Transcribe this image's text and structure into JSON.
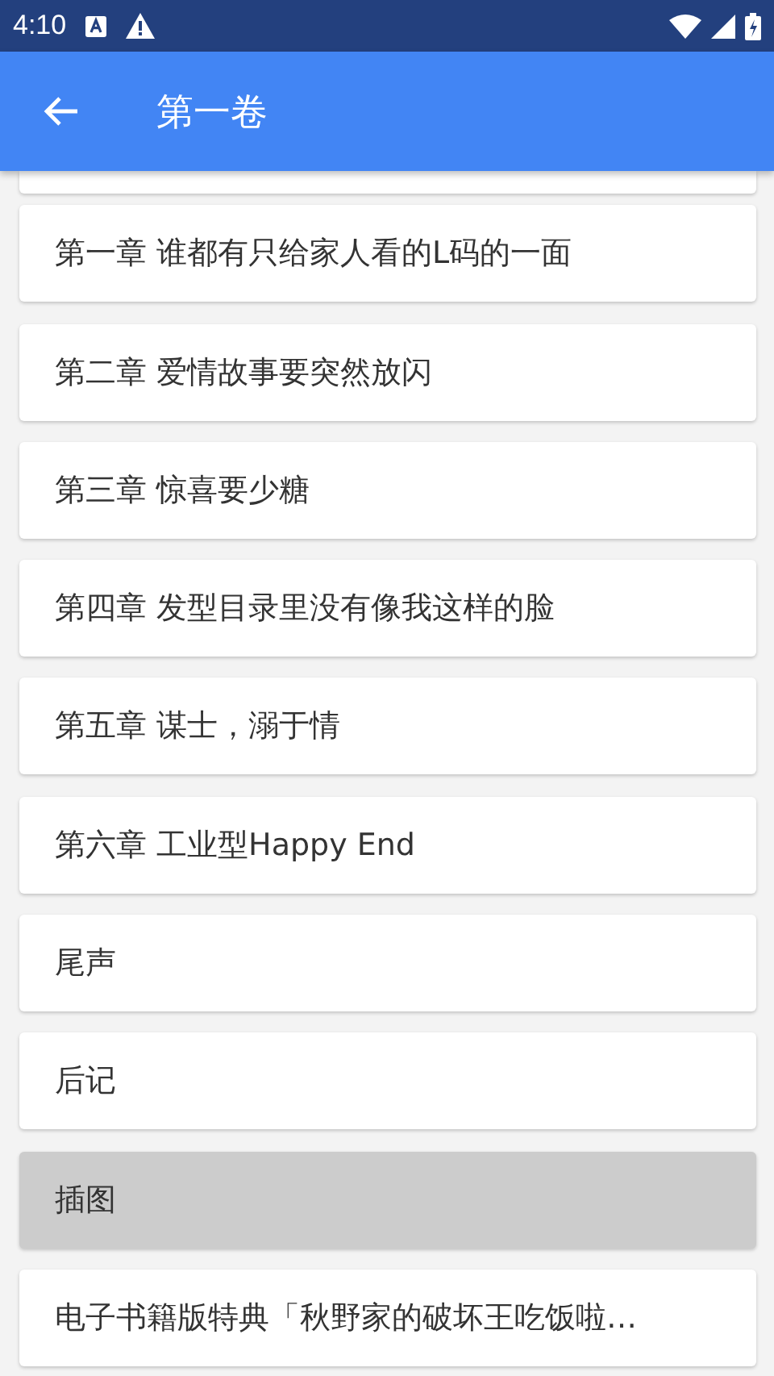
{
  "status_bar": {
    "time": "4:10"
  },
  "app_bar": {
    "title": "第一卷"
  },
  "chapters": [
    {
      "title": "第一章 谁都有只给家人看的L码的一面",
      "selected": false
    },
    {
      "title": "第二章 爱情故事要突然放闪",
      "selected": false
    },
    {
      "title": "第三章 惊喜要少糖",
      "selected": false
    },
    {
      "title": "第四章 发型目录里没有像我这样的脸",
      "selected": false
    },
    {
      "title": "第五章 谋士，溺于情",
      "selected": false
    },
    {
      "title": "第六章 工业型Happy End",
      "selected": false
    },
    {
      "title": "尾声",
      "selected": false
    },
    {
      "title": "后记",
      "selected": false
    },
    {
      "title": "插图",
      "selected": true
    },
    {
      "title": "电子书籍版特典「秋野家的破坏王吃饭啦…",
      "selected": false
    }
  ]
}
